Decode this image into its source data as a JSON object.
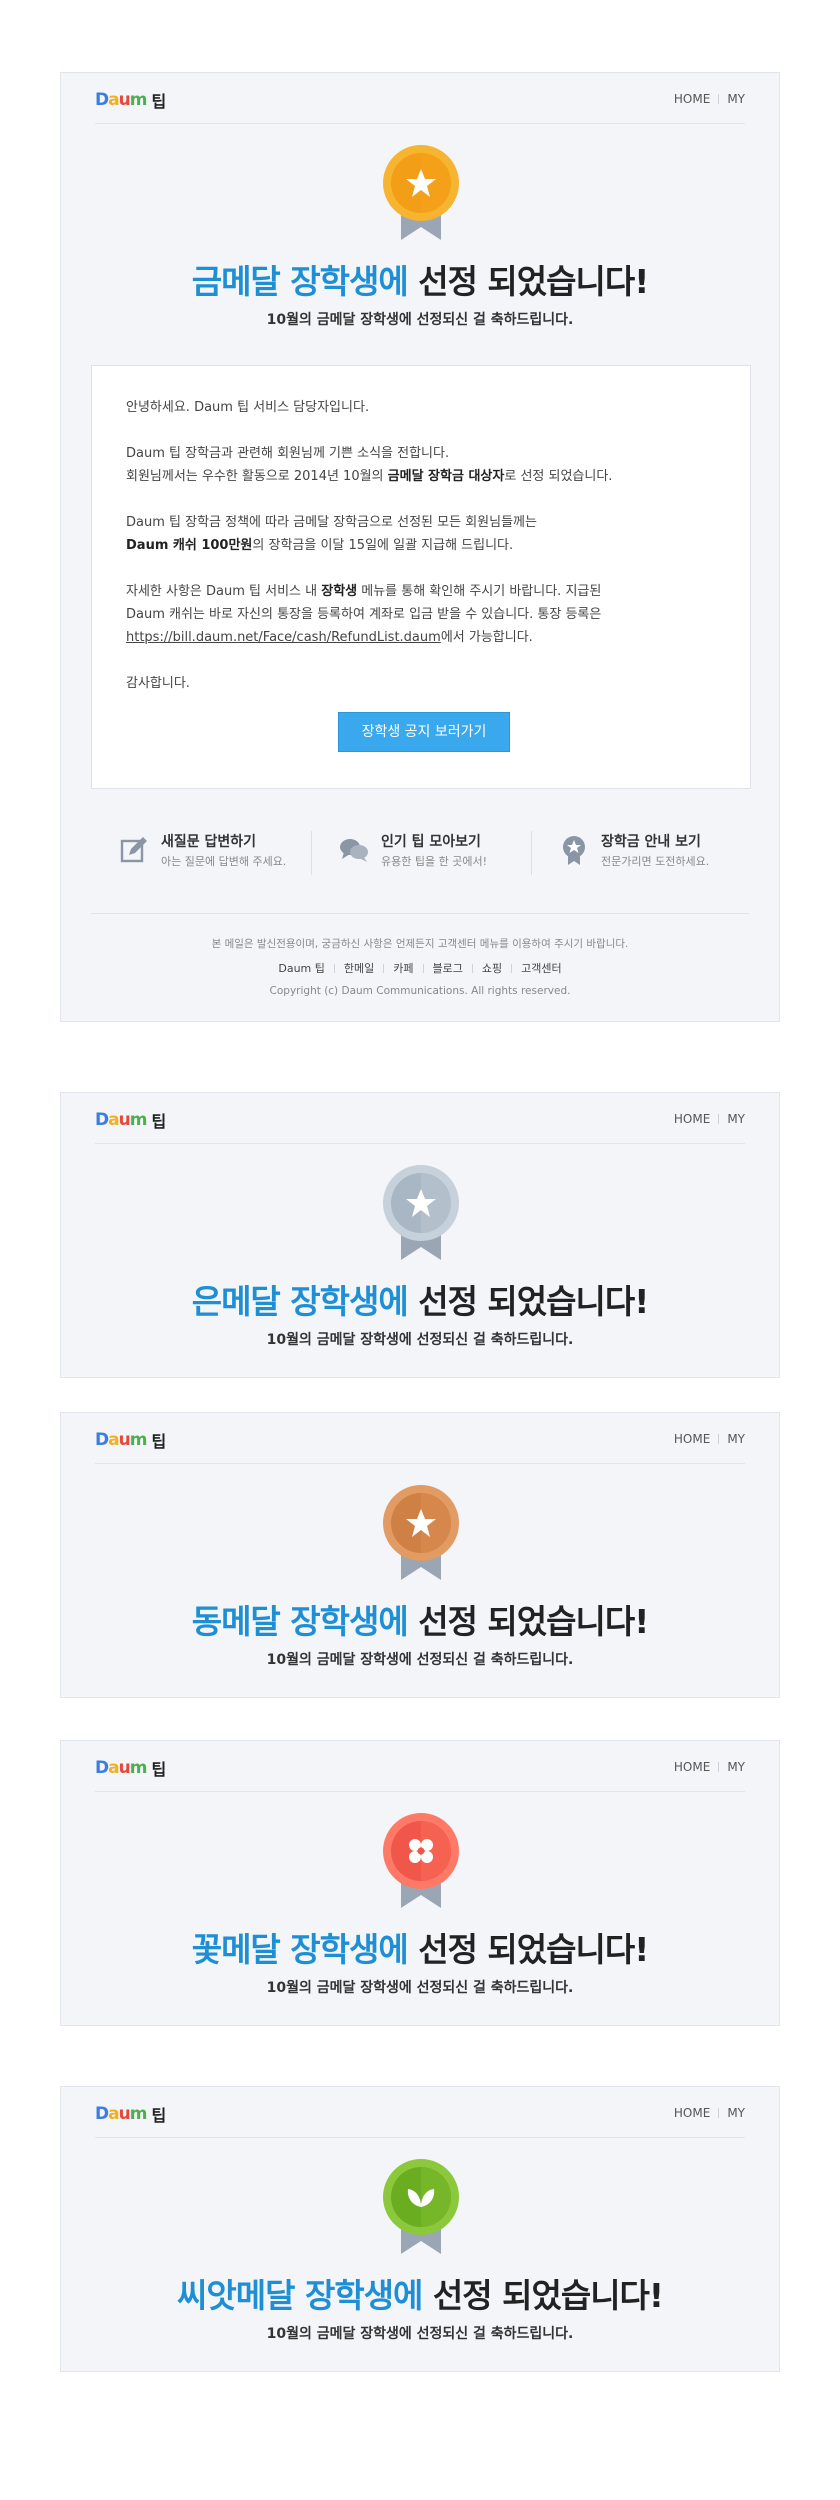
{
  "common": {
    "logo_text": "Daum",
    "logo_tip": "팁",
    "nav_home": "HOME",
    "nav_my": "MY",
    "title_suffix": "선정 되었습니다!",
    "subtitle": "10월의 금메달 장학생에 선정되신 걸 축하드립니다."
  },
  "cards": [
    {
      "medal": "gold",
      "title_highlight": "금메달 장학생에",
      "icon": "star-icon",
      "colors": {
        "rim": "#f6b431",
        "face": "#f29e16",
        "ribbon": "#9aa6b4"
      }
    },
    {
      "medal": "silver",
      "title_highlight": "은메달 장학생에",
      "icon": "star-icon",
      "colors": {
        "rim": "#c7d1dc",
        "face": "#a9b6c4",
        "ribbon": "#9aa6b4"
      }
    },
    {
      "medal": "bronze",
      "title_highlight": "동메달 장학생에",
      "icon": "star-icon",
      "colors": {
        "rim": "#e29b63",
        "face": "#cf8044",
        "ribbon": "#9aa6b4"
      }
    },
    {
      "medal": "flower",
      "title_highlight": "꽃메달 장학생에",
      "icon": "flower-icon",
      "colors": {
        "rim": "#ff7a66",
        "face": "#f0574a",
        "ribbon": "#9aa6b4"
      }
    },
    {
      "medal": "seed",
      "title_highlight": "씨앗메달 장학생에",
      "icon": "sprout-icon",
      "colors": {
        "rim": "#8cc83c",
        "face": "#6aad20",
        "ribbon": "#9aa6b4"
      }
    }
  ],
  "message": {
    "p1": "안녕하세요. Daum 팁 서비스 담당자입니다.",
    "p2a": "Daum 팁 장학금과 관련해 회원님께 기쁜 소식을 전합니다.",
    "p2b_pre": "회원님께서는 우수한 활동으로 2014년 10월의 ",
    "p2b_bold": "금메달 장학금 대상자",
    "p2b_post": "로 선정 되었습니다.",
    "p3a": "Daum 팁 장학금 정책에 따라 금메달 장학금으로 선정된 모든 회원님들께는",
    "p3b_bold": "Daum 캐쉬 100만원",
    "p3b_post": "의 장학금을 이달 15일에 일괄 지급해 드립니다.",
    "p4a_pre": "자세한 사항은 Daum 팁 서비스 내 ",
    "p4a_bold": "장학생",
    "p4a_post": " 메뉴를 통해 확인해 주시기 바랍니다. 지급된",
    "p4b": "Daum 캐쉬는 바로 자신의 통장을 등록하여 계좌로 입금 받을 수 있습니다. 통장 등록은",
    "p4c_link": "https://bill.daum.net/Face/cash/RefundList.daum",
    "p4c_post": "에서 가능합니다.",
    "p5": "감사합니다.",
    "button": "장학생 공지 보러가기"
  },
  "quick_links": [
    {
      "title": "새질문 답변하기",
      "desc": "아는 질문에 답변해 주세요.",
      "icon": "pencil-icon"
    },
    {
      "title": "인기 팁 모아보기",
      "desc": "유용한 팁을 한 곳에서!",
      "icon": "speech-bubbles-icon"
    },
    {
      "title": "장학금 안내 보기",
      "desc": "전문가리면 도전하세요.",
      "icon": "medal-icon"
    }
  ],
  "footer": {
    "notice": "본 메일은 발신전용이며, 궁금하신 사항은 언제든지 고객센터 메뉴를 이용하여 주시기 바랍니다.",
    "links": [
      "Daum 팁",
      "한메일",
      "카페",
      "블로그",
      "쇼핑",
      "고객센터"
    ],
    "copyright": "Copyright (c) Daum Communications. All rights reserved."
  }
}
